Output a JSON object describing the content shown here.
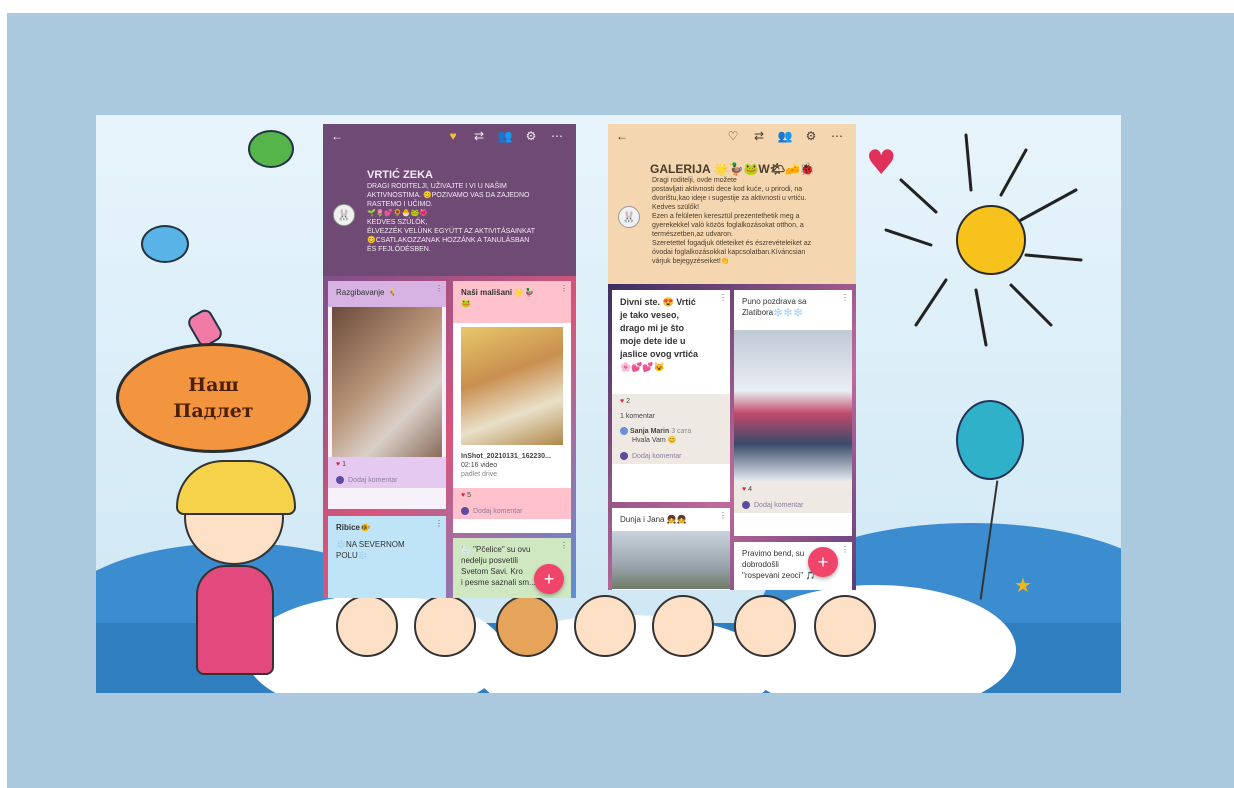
{
  "bubble": {
    "line1": "Наш",
    "line2": "Падлет"
  },
  "left_padlet": {
    "back": "←",
    "toolbar_icons": [
      "heart-icon",
      "repost-icon",
      "share-icon",
      "gear-icon",
      "more-icon"
    ],
    "toolbar_glyphs": [
      "♥",
      "⇄",
      "👥",
      "⚙",
      "⋯"
    ],
    "title": "VRTIĆ ZEKA",
    "avatar": "🐰",
    "description": "DRAGI RODITELJI, UŽIVAJTE I VI U NAŠIM\nAKTIVNOSTIMA. 😊POZIVAMO VAS DA ZAJEDNO\nRASTEMO I UČIMO.\n🌱🌷💕🌻🐣🐸🌺\nKEDVES SZÜLŐK,\nÉLVEZZÉK VELÜNK EGYÜTT AZ AKTIVITÁSAINKAT\n😊CSATLAKOZZANAK HOZZÁNK A TANULÁSBAN\nÉS FEJLŐDÉSBEN.",
    "posts": [
      {
        "title": "Razgibavanje 🤸",
        "likes": "1",
        "comment": "Dodaj komentar"
      },
      {
        "title": "Naši mališani 🌟🦆\n🐸",
        "file": "InShot_20210131_162230...",
        "file_meta": "02:16 video",
        "file_src": "padlet drive",
        "likes": "5",
        "comment": "Dodaj komentar"
      },
      {
        "title": "Ribice🐠",
        "body": "❄️NA SEVERNOM\nPOLU❄️"
      },
      {
        "title": "🦢 \"Pčelice\" su ovu\nnedelju posvetili\nSvetom Savi. Kro\ni pesme saznali sm..."
      }
    ],
    "fab": "+"
  },
  "right_padlet": {
    "back": "←",
    "toolbar_icons": [
      "heart-outline-icon",
      "repost-icon",
      "share-icon",
      "gear-icon",
      "more-icon"
    ],
    "toolbar_glyphs": [
      "♡",
      "⇄",
      "👥",
      "⚙",
      "⋯"
    ],
    "title": "GALERIJA 🌟🦆🐸W🌤🧀🐞",
    "avatar": "🐰",
    "description": "Dragi roditelji, ovde možete\npostavljati aktivnosti dece kod kuće, u prirodi, na\ndvorištu,kao ideje i sugestije za aktivnosti u vrtiću.\nKedves szülők!\nEzen a felületen keresztül prezentethetik meg a\ngyerekekkel való közös foglalkozásokat otthon, a\ntermészetben,az udvaron.\nSzeretettel fogadjuk ötleteiket és észrevételeiket az\nóvodai foglalkozásokkal kapcsolatban.Kíváncsian\nvárjuk bejegyzéseiket!👏",
    "posts": [
      {
        "title": "Divni ste. 😍 Vrtić\nje tako veseo,\ndrago mi je što\nmoje dete ide u\njaslice ovog vrtića\n🌸💕💕😺",
        "likes": "2",
        "comments_count": "1 komentar",
        "commenter": "Sanja Marin",
        "comment_time": "3 сата",
        "comment_text": "Hvala Vam 😊",
        "comment": "Dodaj komentar"
      },
      {
        "title": "Puno pozdrava sa\nZlatibora❄️❄️❄️",
        "likes": "4",
        "comment": "Dodaj komentar"
      },
      {
        "title": "Dunja i Jana 👧👧"
      },
      {
        "title": "Pravimo bend, su\ndobrodošli\n\"rospevani zeoci\" 🎵"
      }
    ],
    "fab": "+"
  },
  "colors": {
    "frame": "#abc9de",
    "left_header": "#6f4a74",
    "right_header": "#f4d7b0",
    "fab": "#f0446b",
    "bubble": "#f3953e"
  }
}
